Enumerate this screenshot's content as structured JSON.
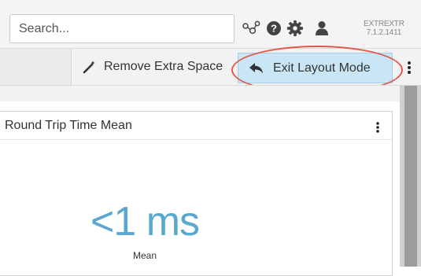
{
  "header": {
    "search_placeholder": "Search...",
    "icons": [
      "activity-icon",
      "help-icon",
      "settings-icon",
      "user-icon"
    ],
    "app_name": "EXTREXTR",
    "app_version": "7.1.2.1411"
  },
  "toolbar": {
    "remove_extra_space_label": "Remove Extra Space",
    "exit_layout_mode_label": "Exit Layout Mode",
    "highlight_color": "#e2574a",
    "exit_button_color": "#c9e6f6"
  },
  "widget": {
    "title": "Round Trip Time Mean",
    "value": "<1 ms",
    "value_label": "Mean",
    "value_color": "#5aa7cf"
  }
}
